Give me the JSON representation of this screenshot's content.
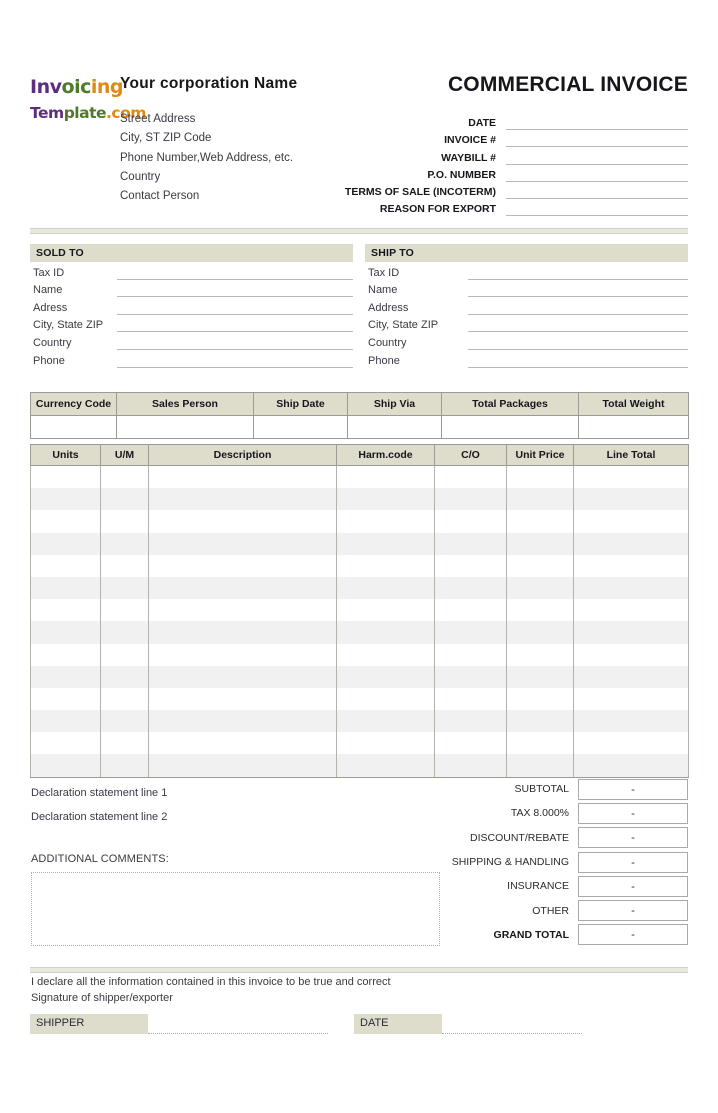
{
  "document": {
    "title": "COMMERCIAL INVOICE"
  },
  "brand": {
    "line1": [
      {
        "t": "I",
        "c": "#5f2d7e"
      },
      {
        "t": "n",
        "c": "#5f2d7e"
      },
      {
        "t": "v",
        "c": "#5f2d7e"
      },
      {
        "t": "o",
        "c": "#4f7a2a"
      },
      {
        "t": "i",
        "c": "#4f7a2a"
      },
      {
        "t": "c",
        "c": "#4f7a2a"
      },
      {
        "t": "i",
        "c": "#e08a12"
      },
      {
        "t": "n",
        "c": "#e08a12"
      },
      {
        "t": "g",
        "c": "#e08a12"
      }
    ],
    "line2": [
      {
        "t": "T",
        "c": "#5f2d7e"
      },
      {
        "t": "e",
        "c": "#5f2d7e"
      },
      {
        "t": "m",
        "c": "#5f2d7e"
      },
      {
        "t": "p",
        "c": "#4f7a2a"
      },
      {
        "t": "l",
        "c": "#4f7a2a"
      },
      {
        "t": "a",
        "c": "#4f7a2a"
      },
      {
        "t": "t",
        "c": "#4f7a2a"
      },
      {
        "t": "e",
        "c": "#4f7a2a"
      },
      {
        "t": ".",
        "c": "#e08a12"
      },
      {
        "t": "c",
        "c": "#e08a12"
      },
      {
        "t": "o",
        "c": "#e08a12"
      },
      {
        "t": "m",
        "c": "#e08a12"
      }
    ]
  },
  "company": {
    "name": "Your corporation  Name",
    "lines": [
      "Street Address",
      "City, ST  ZIP Code",
      "Phone Number,Web Address, etc.",
      "Country",
      "Contact Person"
    ]
  },
  "meta": {
    "rows": [
      {
        "label": "DATE",
        "value": ""
      },
      {
        "label": "INVOICE #",
        "value": ""
      },
      {
        "label": "WAYBILL #",
        "value": ""
      },
      {
        "label": "P.O. NUMBER",
        "value": ""
      },
      {
        "label": "TERMS OF SALE (INCOTERM)",
        "value": ""
      },
      {
        "label": "REASON FOR EXPORT",
        "value": ""
      }
    ]
  },
  "sold_to": {
    "heading": "SOLD  TO",
    "rows": [
      {
        "label": "Tax ID",
        "value": ""
      },
      {
        "label": "Name",
        "value": ""
      },
      {
        "label": "Adress",
        "value": ""
      },
      {
        "label": "City, State ZIP",
        "value": ""
      },
      {
        "label": "Country",
        "value": ""
      },
      {
        "label": "Phone",
        "value": ""
      }
    ]
  },
  "ship_to": {
    "heading": "SHIP TO",
    "rows": [
      {
        "label": "Tax ID",
        "value": ""
      },
      {
        "label": "Name",
        "value": ""
      },
      {
        "label": "Address",
        "value": ""
      },
      {
        "label": "City, State ZIP",
        "value": ""
      },
      {
        "label": "Country",
        "value": ""
      },
      {
        "label": "Phone",
        "value": ""
      }
    ]
  },
  "shipping_info": {
    "headers": [
      "Currency Code",
      "Sales Person",
      "Ship Date",
      "Ship Via",
      "Total Packages",
      "Total Weight"
    ],
    "values": [
      "",
      "",
      "",
      "",
      "",
      ""
    ]
  },
  "items": {
    "headers": [
      "Units",
      "U/M",
      "Description",
      "Harm.code",
      "C/O",
      "Unit Price",
      "Line Total"
    ],
    "row_count": 14,
    "rows": []
  },
  "declaration": {
    "line1": "Declaration statement line 1",
    "line2": "Declaration statement line 2"
  },
  "comments": {
    "label": "ADDITIONAL COMMENTS:",
    "value": ""
  },
  "totals": {
    "rows": [
      {
        "label": "SUBTOTAL",
        "value": "-",
        "bold": false
      },
      {
        "label": "TAX   8.000%",
        "value": "-",
        "bold": false
      },
      {
        "label": "DISCOUNT/REBATE",
        "value": "-",
        "bold": false
      },
      {
        "label": "SHIPPING & HANDLING",
        "value": "-",
        "bold": false
      },
      {
        "label": "INSURANCE",
        "value": "-",
        "bold": false
      },
      {
        "label": "OTHER",
        "value": "-",
        "bold": false
      },
      {
        "label": "GRAND TOTAL",
        "value": "-",
        "bold": true
      }
    ]
  },
  "footer": {
    "declare_line": "I declare all the information contained in this invoice to be true and correct",
    "signature_line": "Signature of shipper/exporter",
    "shipper_label": "SHIPPER",
    "shipper_value": "",
    "date_label": "DATE",
    "date_value": ""
  },
  "colors": {
    "header_fill": "#dedcca",
    "row_stripe": "#f1f1f1",
    "border": "#9b9b93",
    "rule": "#b9b9b9"
  }
}
